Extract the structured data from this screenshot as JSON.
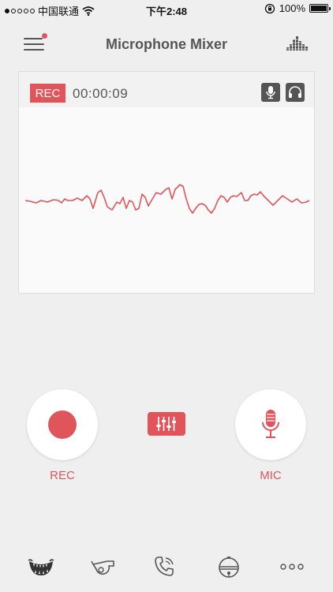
{
  "status_bar": {
    "carrier": "中国联通",
    "time": "下午2:48",
    "battery": "100%"
  },
  "nav": {
    "title": "Microphone Mixer"
  },
  "recorder": {
    "badge": "REC",
    "timer": "00:00:09"
  },
  "controls": {
    "rec_label": "REC",
    "mic_label": "MIC"
  },
  "tabs": [
    {
      "icon": "mouth-icon"
    },
    {
      "icon": "whistle-icon"
    },
    {
      "icon": "phone-icon"
    },
    {
      "icon": "bell-icon"
    },
    {
      "icon": "more-icon"
    }
  ],
  "colors": {
    "accent": "#e0555b",
    "background": "#efefef",
    "text_dark": "#555555"
  }
}
